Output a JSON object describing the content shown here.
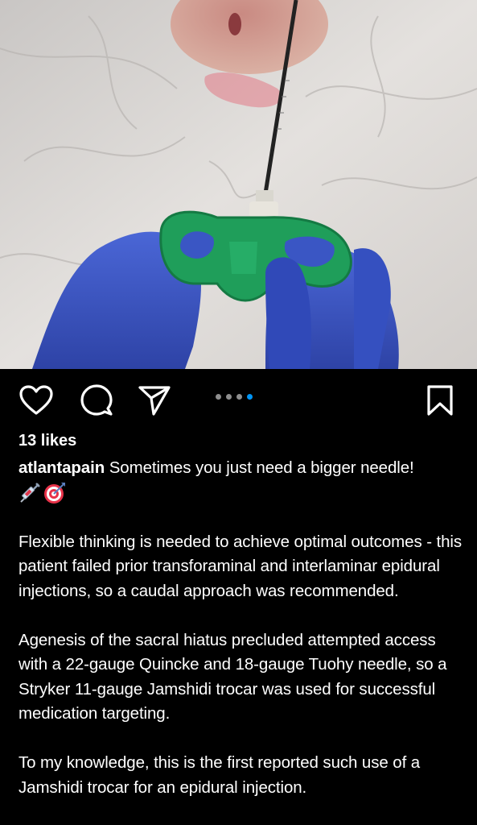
{
  "post": {
    "image_alt": "Gloved hands holding a green-handled Jamshidi trocar needle inserted through sterile drape",
    "pagination": {
      "count": 4,
      "active_index": 3
    },
    "likes_text": "13 likes",
    "username": "atlantapain",
    "caption_first": " Sometimes you just need a bigger needle!",
    "emojis": [
      "syringe-icon",
      "direct-hit-icon"
    ],
    "paragraph_1": "Flexible thinking is needed to achieve optimal outcomes - this patient failed prior transforaminal and interlaminar epidural injections, so a caudal approach was recommended.",
    "paragraph_2": "Agenesis of the sacral hiatus precluded attempted access with a 22-gauge Quincke and 18-gauge Tuohy needle, so a Stryker 11-gauge Jamshidi trocar was used for successful medication targeting.",
    "paragraph_3": "To my knowledge, this is the first reported such use of a Jamshidi trocar for an epidural injection."
  },
  "colors": {
    "background": "#000000",
    "text": "#ffffff",
    "active_dot": "#0095f6",
    "inactive_dot": "#8e8e8e",
    "trocar_handle": "#1f9e5a",
    "glove": "#3d58c8"
  },
  "icons": {
    "like": "heart-icon",
    "comment": "comment-icon",
    "share": "send-icon",
    "save": "bookmark-icon"
  }
}
